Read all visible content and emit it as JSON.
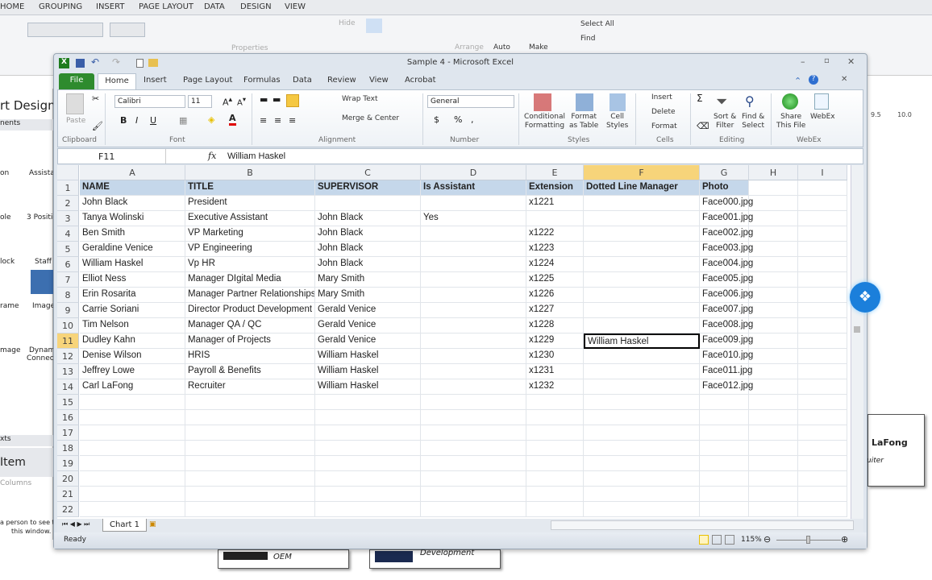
{
  "background_app": {
    "tabs": [
      "HOME",
      "GROUPING",
      "INSERT",
      "PAGE LAYOUT",
      "DATA",
      "DESIGN",
      "VIEW"
    ],
    "ribbon": {
      "hide": "Hide",
      "properties": "Properties",
      "arrange": "Arrange",
      "auto": "Auto",
      "make": "Make",
      "select_all": "Select All",
      "find": "Find"
    },
    "left_panel": {
      "title": "rt Design",
      "section": "nents",
      "items": [
        "on",
        "Assista",
        "ole",
        "3 Positio",
        "lock",
        "Staff",
        "rame",
        "Image",
        "mage",
        "Dynam",
        "Connect"
      ],
      "texts": "xts",
      "item_header": "Item",
      "columns": "Columns",
      "hint1": "a person to see t",
      "hint2": "this window."
    },
    "cards": [
      {
        "name": "LaFong",
        "role": "uiter"
      },
      {
        "role": "OEM"
      },
      {
        "role": "Development"
      }
    ],
    "ruler": [
      "9.5",
      "10.0"
    ]
  },
  "excel": {
    "title": "Sample 4 - Microsoft Excel",
    "tabs": [
      "File",
      "Home",
      "Insert",
      "Page Layout",
      "Formulas",
      "Data",
      "Review",
      "View",
      "Acrobat"
    ],
    "ribbon": {
      "paste": "Paste",
      "font_name": "Calibri",
      "font_size": "11",
      "wrap_text": "Wrap Text",
      "merge_center": "Merge & Center",
      "number_format": "General",
      "currency": "$",
      "percent": "%",
      "comma": ",",
      "conditional": [
        "Conditional",
        "Formatting"
      ],
      "format_table": [
        "Format",
        "as Table"
      ],
      "cell_styles": [
        "Cell",
        "Styles"
      ],
      "insert": "Insert",
      "delete": "Delete",
      "format": "Format",
      "sort": [
        "Sort &",
        "Filter"
      ],
      "find": [
        "Find &",
        "Select"
      ],
      "share": [
        "Share",
        "This File"
      ],
      "webex": "WebEx",
      "groups": [
        "Clipboard",
        "Font",
        "Alignment",
        "Number",
        "Styles",
        "Cells",
        "Editing",
        "WebEx"
      ]
    },
    "name_box": "F11",
    "formula": "William Haskel",
    "columns": [
      "A",
      "B",
      "C",
      "D",
      "E",
      "F",
      "G",
      "H",
      "I"
    ],
    "selected_cell": "F11",
    "rows": [
      [
        "NAME",
        "TITLE",
        "SUPERVISOR",
        "Is Assistant",
        "Extension",
        "Dotted Line Manager",
        "Photo"
      ],
      [
        "John Black",
        "President",
        "",
        "",
        "x1221",
        "",
        "Face000.jpg"
      ],
      [
        "Tanya Wolinski",
        "Executive Assistant",
        "John Black",
        "Yes",
        "",
        "",
        "Face001.jpg"
      ],
      [
        "Ben Smith",
        "VP Marketing",
        "John Black",
        "",
        "x1222",
        "",
        "Face002.jpg"
      ],
      [
        "Geraldine Venice",
        "VP Engineering",
        "John Black",
        "",
        "x1223",
        "",
        "Face003.jpg"
      ],
      [
        "William Haskel",
        "Vp HR",
        "John Black",
        "",
        "x1224",
        "",
        "Face004.jpg"
      ],
      [
        "Elliot Ness",
        "Manager DIgital Media",
        "Mary Smith",
        "",
        "x1225",
        "",
        "Face005.jpg"
      ],
      [
        "Erin Rosarita",
        "Manager Partner Relationships",
        "Mary Smith",
        "",
        "x1226",
        "",
        "Face006.jpg"
      ],
      [
        "Carrie Soriani",
        "Director Product Development",
        "Gerald Venice",
        "",
        "x1227",
        "",
        "Face007.jpg"
      ],
      [
        "Tim Nelson",
        "Manager QA / QC",
        "Gerald Venice",
        "",
        "x1228",
        "",
        "Face008.jpg"
      ],
      [
        "Dudley Kahn",
        "Manager of Projects",
        "Gerald Venice",
        "",
        "x1229",
        "William Haskel",
        "Face009.jpg"
      ],
      [
        "Denise Wilson",
        "HRIS",
        "William Haskel",
        "",
        "x1230",
        "",
        "Face010.jpg"
      ],
      [
        "Jeffrey Lowe",
        "Payroll & Benefits",
        "William Haskel",
        "",
        "x1231",
        "",
        "Face011.jpg"
      ],
      [
        "Carl LaFong",
        "Recruiter",
        "William Haskel",
        "",
        "x1232",
        "",
        "Face012.jpg"
      ]
    ],
    "total_rows": 22,
    "sheet_tab": "Chart 1",
    "status": "Ready",
    "zoom": "115%",
    "colors": {
      "file_tab": "#2e8b2e",
      "header_fill": "#c5d7ea",
      "selected_col": "#f7d47a"
    }
  }
}
